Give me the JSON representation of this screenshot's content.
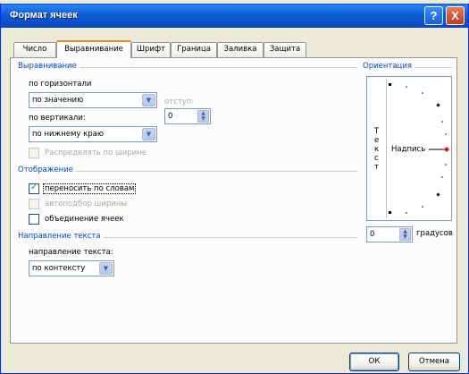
{
  "window": {
    "title": "Формат ячеек",
    "help_label": "?",
    "close_label": "X"
  },
  "tabs": [
    {
      "label": "Число"
    },
    {
      "label": "Выравнивание"
    },
    {
      "label": "Шрифт"
    },
    {
      "label": "Граница"
    },
    {
      "label": "Заливка"
    },
    {
      "label": "Защита"
    }
  ],
  "alignment": {
    "section_title": "Выравнивание",
    "horizontal_label": "по горизонтали",
    "horizontal_value": "по значению",
    "indent_label": "отступ:",
    "indent_value": "0",
    "vertical_label": "по вертикали:",
    "vertical_value": "по нижнему краю",
    "distribute_label": "Распределять по ширине",
    "distribute_checked": false
  },
  "display": {
    "section_title": "Отображение",
    "wrap_label": "переносить по словам",
    "wrap_checked": true,
    "shrink_label": "автоподбор ширины",
    "shrink_checked": false,
    "merge_label": "объединение ячеек",
    "merge_checked": false
  },
  "direction": {
    "section_title": "Направление текста",
    "label": "направление текста:",
    "value": "по контексту"
  },
  "orientation": {
    "section_title": "Ориентация",
    "vertical_chars": [
      "Т",
      "е",
      "к",
      "с",
      "т"
    ],
    "dial_label": "Надпись",
    "degrees_value": "0",
    "degrees_label": "градусов",
    "accent_color": "#e00000"
  },
  "buttons": {
    "ok": "ОК",
    "cancel": "Отмена"
  }
}
